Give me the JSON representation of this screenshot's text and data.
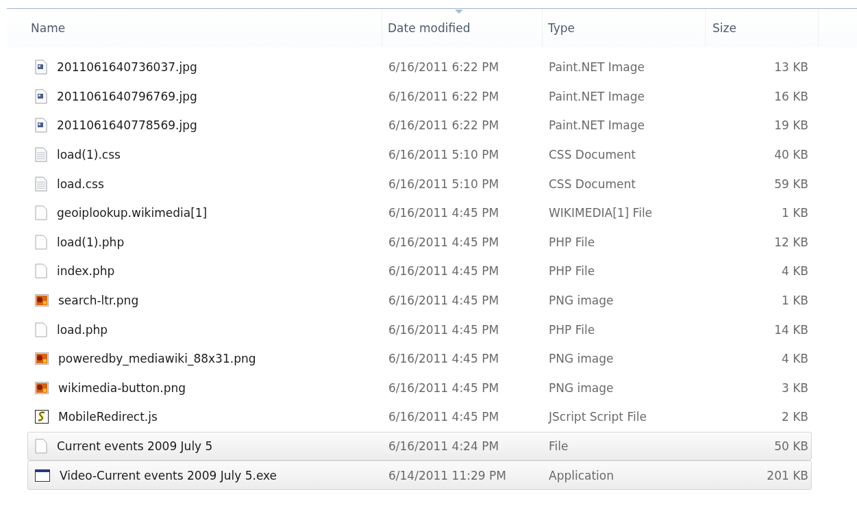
{
  "columns": [
    {
      "label": "Name",
      "sorted": false
    },
    {
      "label": "Date modified",
      "sorted": true
    },
    {
      "label": "Type",
      "sorted": false
    },
    {
      "label": "Size",
      "sorted": false
    }
  ],
  "rows": [
    {
      "kind": "image",
      "name": "2011061640736037.jpg",
      "date": "6/16/2011 6:22 PM",
      "type": "Paint.NET Image",
      "size": "13 KB",
      "selected": false
    },
    {
      "kind": "image",
      "name": "2011061640796769.jpg",
      "date": "6/16/2011 6:22 PM",
      "type": "Paint.NET Image",
      "size": "16 KB",
      "selected": false
    },
    {
      "kind": "image",
      "name": "2011061640778569.jpg",
      "date": "6/16/2011 6:22 PM",
      "type": "Paint.NET Image",
      "size": "19 KB",
      "selected": false
    },
    {
      "kind": "text",
      "name": "load(1).css",
      "date": "6/16/2011 5:10 PM",
      "type": "CSS Document",
      "size": "40 KB",
      "selected": false
    },
    {
      "kind": "text",
      "name": "load.css",
      "date": "6/16/2011 5:10 PM",
      "type": "CSS Document",
      "size": "59 KB",
      "selected": false
    },
    {
      "kind": "blank",
      "name": "geoiplookup.wikimedia[1]",
      "date": "6/16/2011 4:45 PM",
      "type": "WIKIMEDIA[1] File",
      "size": "1 KB",
      "selected": false
    },
    {
      "kind": "blank",
      "name": "load(1).php",
      "date": "6/16/2011 4:45 PM",
      "type": "PHP File",
      "size": "12 KB",
      "selected": false
    },
    {
      "kind": "blank",
      "name": "index.php",
      "date": "6/16/2011 4:45 PM",
      "type": "PHP File",
      "size": "4 KB",
      "selected": false
    },
    {
      "kind": "png",
      "name": "search-ltr.png",
      "date": "6/16/2011 4:45 PM",
      "type": "PNG image",
      "size": "1 KB",
      "selected": false
    },
    {
      "kind": "blank",
      "name": "load.php",
      "date": "6/16/2011 4:45 PM",
      "type": "PHP File",
      "size": "14 KB",
      "selected": false
    },
    {
      "kind": "png",
      "name": "poweredby_mediawiki_88x31.png",
      "date": "6/16/2011 4:45 PM",
      "type": "PNG image",
      "size": "4 KB",
      "selected": false
    },
    {
      "kind": "png",
      "name": "wikimedia-button.png",
      "date": "6/16/2011 4:45 PM",
      "type": "PNG image",
      "size": "3 KB",
      "selected": false
    },
    {
      "kind": "script",
      "name": "MobileRedirect.js",
      "date": "6/16/2011 4:45 PM",
      "type": "JScript Script File",
      "size": "2 KB",
      "selected": false
    },
    {
      "kind": "blank",
      "name": "Current events 2009 July 5",
      "date": "6/16/2011 4:24 PM",
      "type": "File",
      "size": "50 KB",
      "selected": true
    },
    {
      "kind": "app",
      "name": "Video-Current events 2009 July 5.exe",
      "date": "6/14/2011 11:29 PM",
      "type": "Application",
      "size": "201 KB",
      "selected": true
    }
  ]
}
